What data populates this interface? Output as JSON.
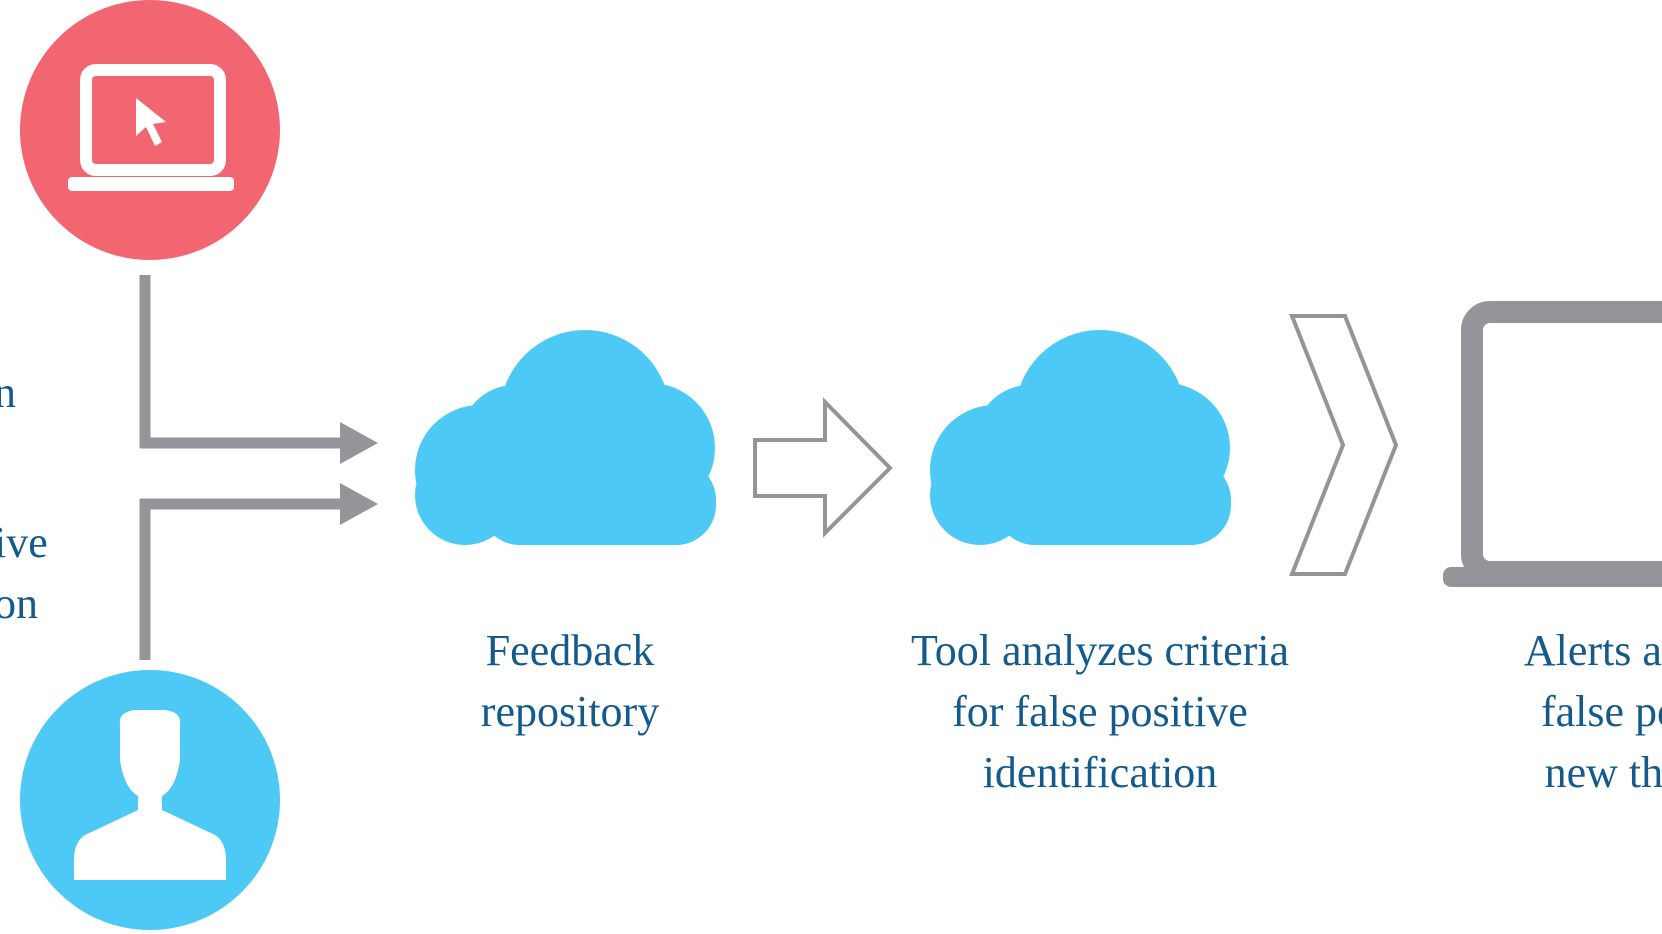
{
  "colors": {
    "red_circle": "#f26672",
    "blue": "#4cc9f5",
    "gray": "#939598",
    "text": "#145a8d"
  },
  "left_labels": {
    "top": [
      "n"
    ],
    "bottom": [
      "ive",
      "on"
    ]
  },
  "steps": [
    {
      "icon": "cloud-icon",
      "lines": [
        "Feedback",
        "repository"
      ]
    },
    {
      "icon": "cloud-icon",
      "lines": [
        "Tool analyzes criteria",
        "for false positive",
        "identification"
      ]
    },
    {
      "icon": "laptop-icon",
      "lines": [
        "Alerts are",
        "false po",
        "new thi"
      ]
    }
  ]
}
